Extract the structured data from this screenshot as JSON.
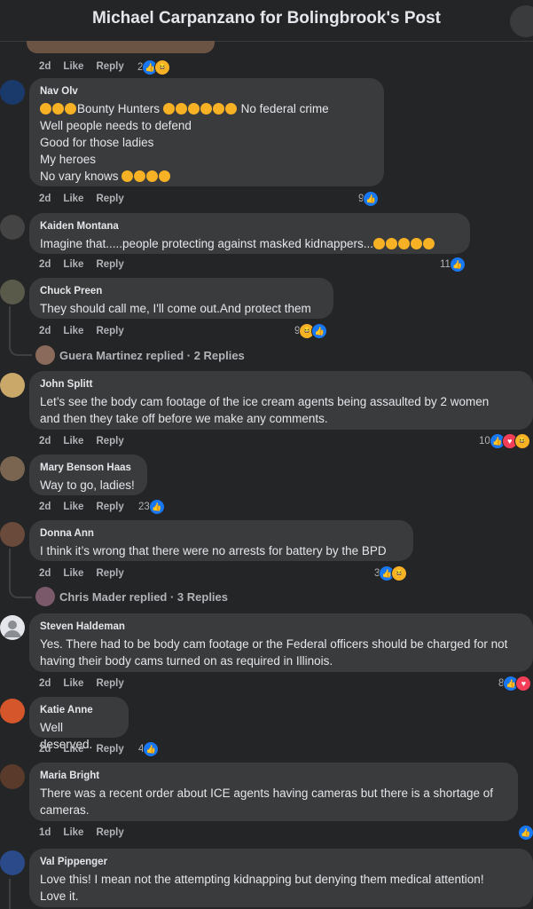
{
  "header": {
    "title": "Michael Carpanzano for Bolingbrook's Post"
  },
  "actions": {
    "like": "Like",
    "reply": "Reply"
  },
  "top": {
    "time": "2d",
    "count": "2"
  },
  "comments": [
    {
      "name": "Nav Olv",
      "time": "2d",
      "count": "9"
    },
    {
      "name": "Kaiden Montana",
      "text": "Imagine that.....people protecting against masked kidnappers...",
      "time": "2d",
      "count": "11"
    },
    {
      "name": "Chuck Preen",
      "text": "They should call me, I'll come out.And protect them",
      "time": "2d",
      "count": "9",
      "replies": "Guera Martinez replied · 2 Replies"
    },
    {
      "name": "John Splitt",
      "text": "Let’s see the body cam footage of the ice cream agents being assaulted by 2 women\nand then they take off before we make any comments.",
      "time": "2d",
      "count": "10"
    },
    {
      "name": "Mary Benson Haas",
      "text": "Way to go, ladies!",
      "time": "2d",
      "count": "23"
    },
    {
      "name": "Donna Ann",
      "text": "I think it’s wrong that there were no arrests for battery by the BPD",
      "time": "2d",
      "count": "3",
      "replies": "Chris Mader replied · 3 Replies"
    },
    {
      "name": "Steven Haldeman",
      "text": "Yes. There had to be body cam footage or the Federal officers should be charged for not\nhaving their body cams turned on as required in Illinois.",
      "time": "2d",
      "count": "8"
    },
    {
      "name": "Katie Anne",
      "text": "Well deserved.",
      "time": "2d",
      "count": "4"
    },
    {
      "name": "Maria Bright",
      "text": "There was a recent order about ICE agents having cameras but there is a shortage of\ncameras.",
      "time": "1d"
    },
    {
      "name": "Val Pippenger",
      "text": "Love this! I mean not the attempting kidnapping but denying them medical attention!\nLove it."
    }
  ],
  "navolv": {
    "seg1": "Bounty Hunters",
    "seg2": " No federal crime",
    "line2": "Well people needs to defend",
    "line3": "Good for those ladies",
    "line4": "My heroes",
    "line5": "No vary knows "
  }
}
